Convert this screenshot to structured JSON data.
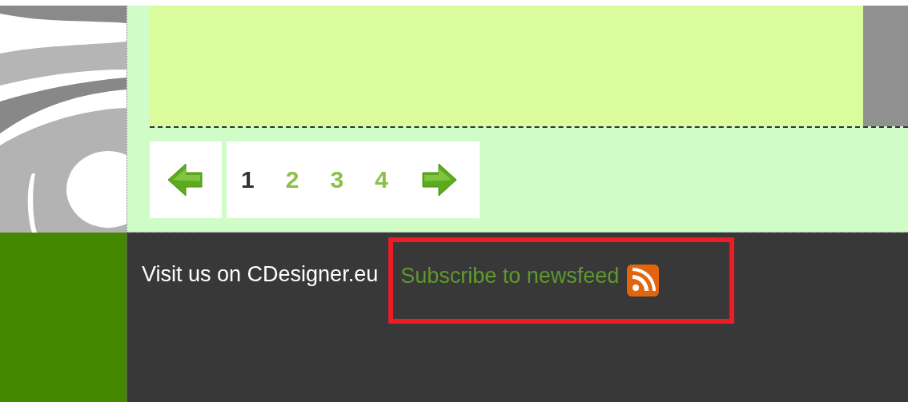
{
  "pagination": {
    "pages": [
      {
        "label": "1",
        "selected": true
      },
      {
        "label": "2",
        "selected": false
      },
      {
        "label": "3",
        "selected": false
      },
      {
        "label": "4",
        "selected": false
      }
    ]
  },
  "footer": {
    "visit_text": "Visit us on CDesigner.eu",
    "subscribe_link": "Subscribe to newsfeed",
    "highlighted": true
  }
}
